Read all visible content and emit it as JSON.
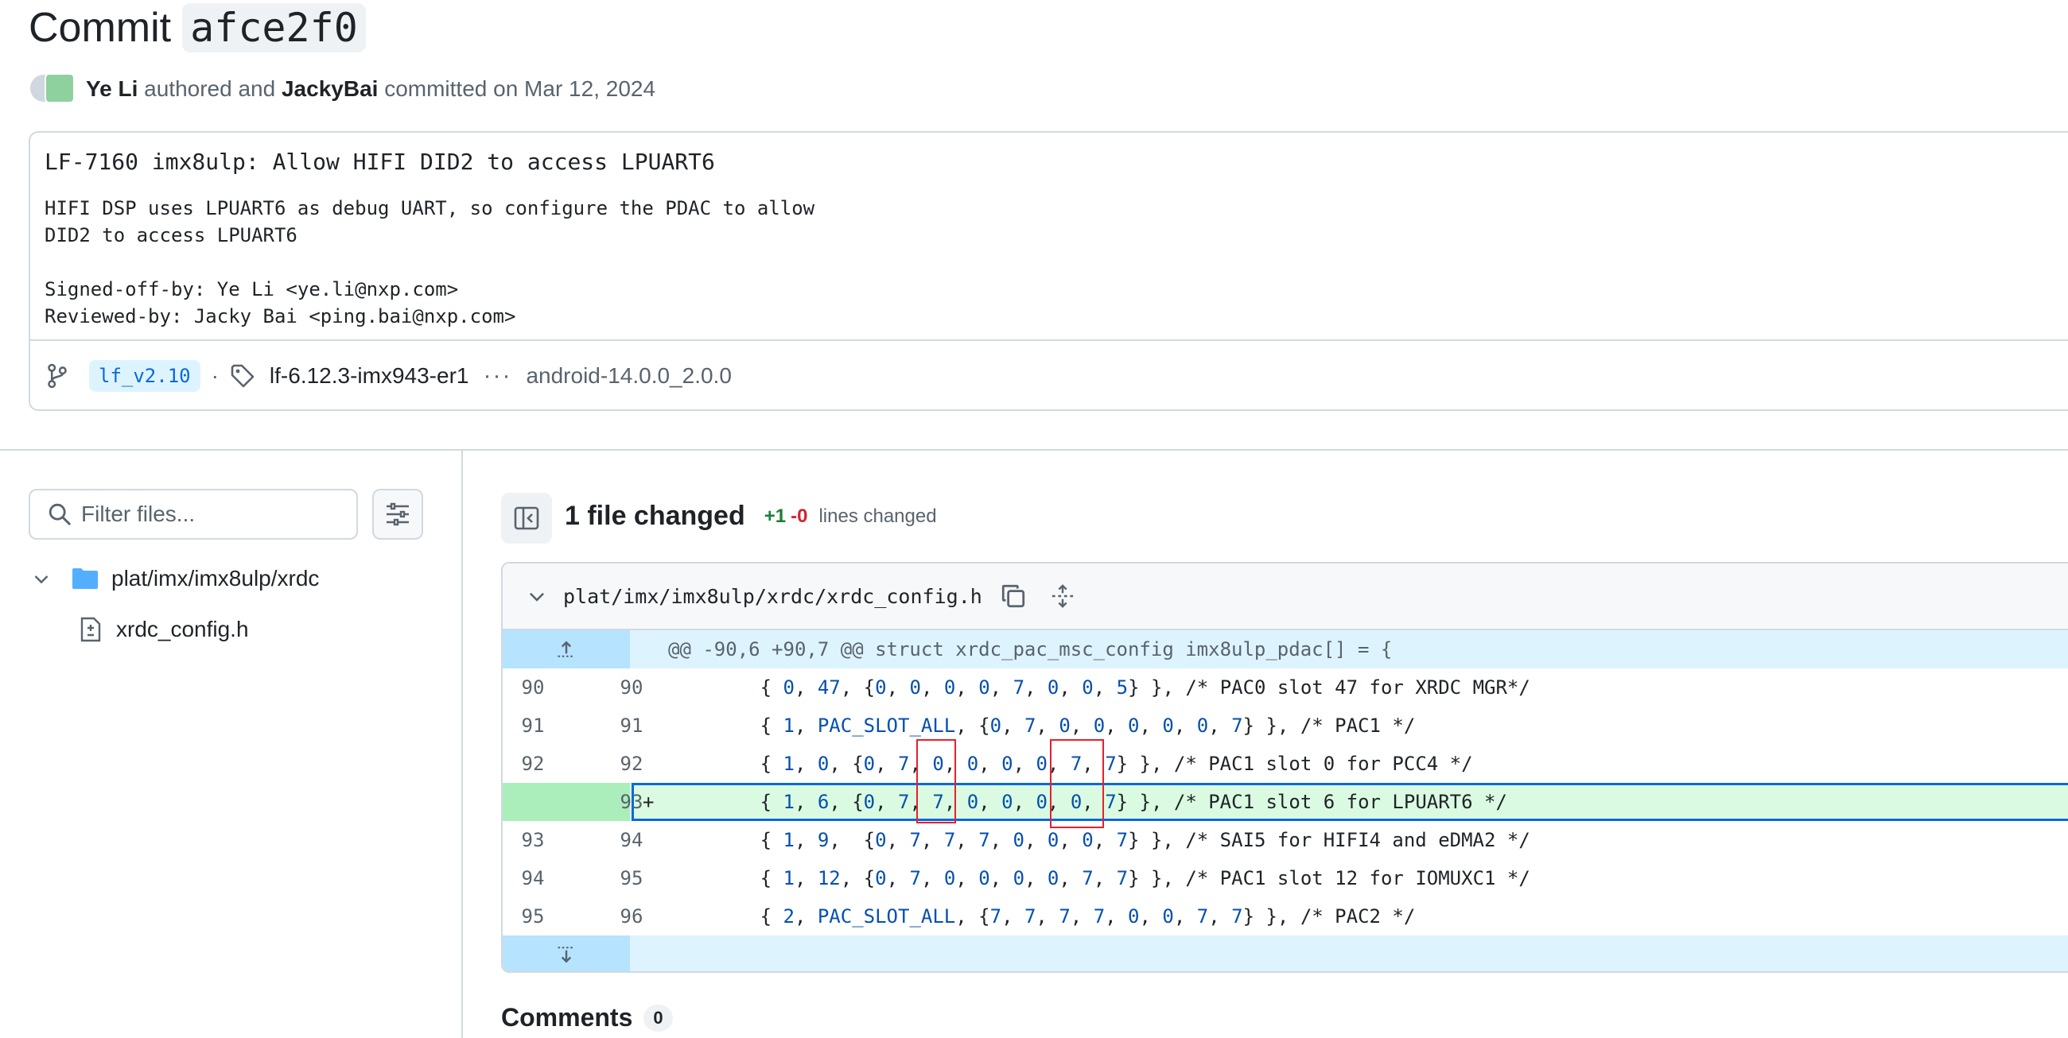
{
  "header": {
    "title_prefix": "Commit",
    "sha": "afce2f0",
    "author": "Ye Li",
    "authored_text": "authored and",
    "committer": "JackyBai",
    "committed_text": "committed on Mar 12, 2024"
  },
  "message": {
    "title": "LF-7160 imx8ulp: Allow HIFI DID2 to access LPUART6",
    "body": "HIFI DSP uses LPUART6 as debug UART, so configure the PDAC to allow\nDID2 to access LPUART6\n\nSigned-off-by: Ye Li <ye.li@nxp.com>\nReviewed-by: Jacky Bai <ping.bai@nxp.com>",
    "branch": "lf_v2.10",
    "separator": "·",
    "tag": "lf-6.12.3-imx943-er1",
    "more": "···",
    "last_tag": "android-14.0.0_2.0.0"
  },
  "sidebar": {
    "filter_placeholder": "Filter files...",
    "directory": "plat/imx/imx8ulp/xrdc",
    "file": "xrdc_config.h"
  },
  "summary": {
    "files_changed": "1 file changed",
    "additions": "+1",
    "deletions": "-0",
    "lines_changed": "lines changed"
  },
  "diff": {
    "path": "plat/imx/imx8ulp/xrdc/xrdc_config.h",
    "hunk": "@@ -90,6 +90,7 @@ struct xrdc_pac_msc_config imx8ulp_pdac[] = {",
    "lines": [
      {
        "old": "90",
        "new": "90",
        "sign": "",
        "code": "        { 0, 47, {0, 0, 0, 0, 7, 0, 0, 5} }, /* PAC0 slot 47 for XRDC MGR*/"
      },
      {
        "old": "91",
        "new": "91",
        "sign": "",
        "code": "        { 1, PAC_SLOT_ALL, {0, 7, 0, 0, 0, 0, 0, 7} }, /* PAC1 */"
      },
      {
        "old": "92",
        "new": "92",
        "sign": "",
        "code": "        { 1, 0, {0, 7, 0, 0, 0, 0, 7, 7} }, /* PAC1 slot 0 for PCC4 */"
      },
      {
        "old": "",
        "new": "93",
        "sign": "+",
        "code": "        { 1, 6, {0, 7, 7, 0, 0, 0, 0, 7} }, /* PAC1 slot 6 for LPUART6 */"
      },
      {
        "old": "93",
        "new": "94",
        "sign": "",
        "code": "        { 1, 9,  {0, 7, 7, 7, 0, 0, 0, 7} }, /* SAI5 for HIFI4 and eDMA2 */"
      },
      {
        "old": "94",
        "new": "95",
        "sign": "",
        "code": "        { 1, 12, {0, 7, 0, 0, 0, 0, 7, 7} }, /* PAC1 slot 12 for IOMUXC1 */"
      },
      {
        "old": "95",
        "new": "96",
        "sign": "",
        "code": "        { 2, PAC_SLOT_ALL, {7, 7, 7, 7, 0, 0, 7, 7} }, /* PAC2 */"
      }
    ]
  },
  "comments": {
    "label": "Comments",
    "count": "0"
  },
  "colors": {
    "accent": "#0969da",
    "added_bg": "#dafbe1",
    "hunk_bg": "#ddf4ff",
    "annotation_red": "#e5202e"
  }
}
